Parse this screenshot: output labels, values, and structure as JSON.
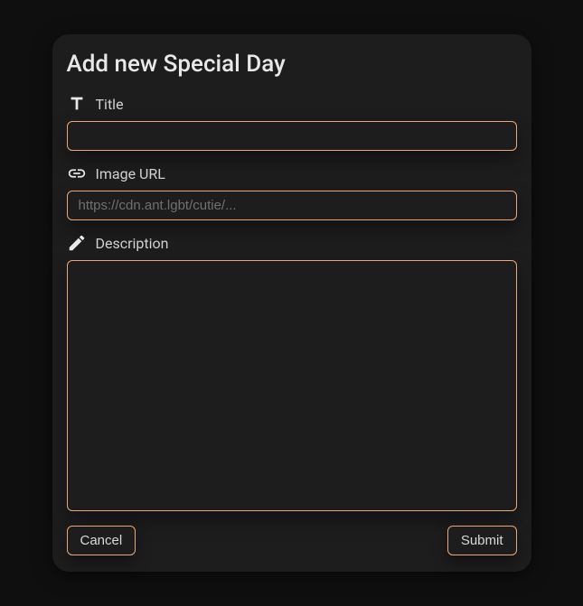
{
  "modal": {
    "title": "Add new Special Day",
    "fields": {
      "title": {
        "label": "Title",
        "value": ""
      },
      "imageUrl": {
        "label": "Image URL",
        "placeholder": "https://cdn.ant.lgbt/cutie/...",
        "value": ""
      },
      "description": {
        "label": "Description",
        "value": ""
      }
    },
    "buttons": {
      "cancel": "Cancel",
      "submit": "Submit"
    }
  }
}
